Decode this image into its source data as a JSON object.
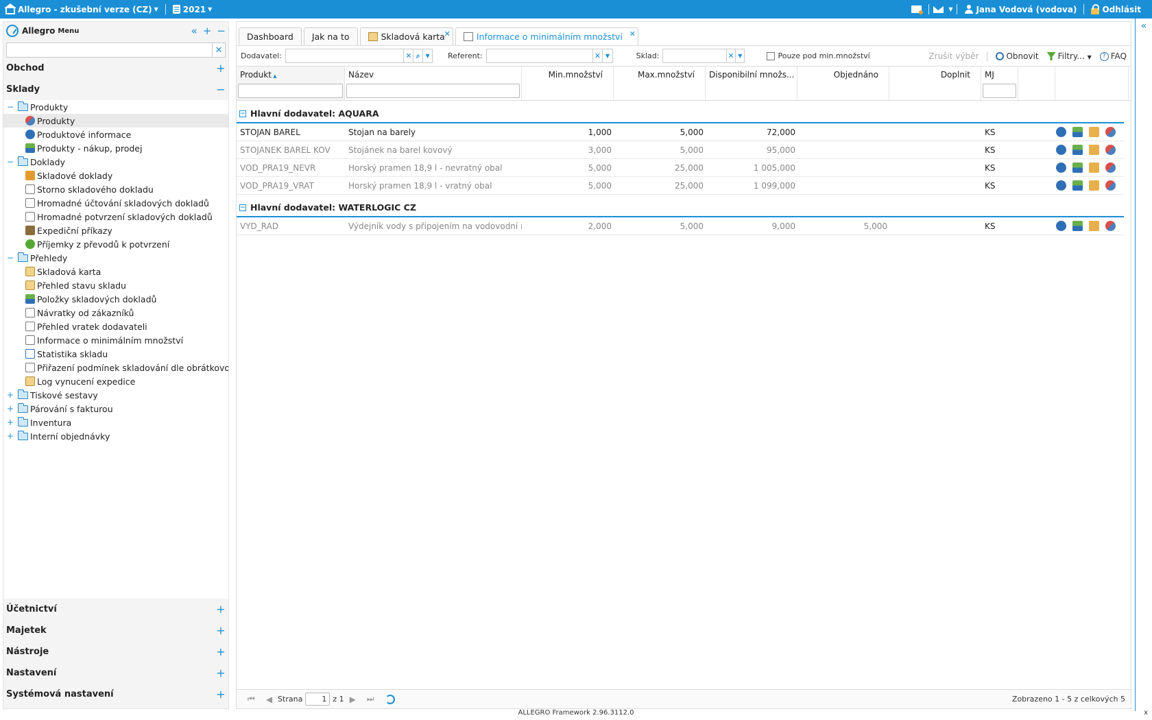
{
  "topbar": {
    "app_title": "Allegro - zkušební verze (CZ)",
    "year": "2021",
    "user": "Jana Vodová (vodova)",
    "logout": "Odhlásit"
  },
  "sidebar": {
    "logo": "Allegro",
    "menu_label": "Menu",
    "search_placeholder": "",
    "sections_top": [
      {
        "label": "Obchod",
        "toggle": "+"
      },
      {
        "label": "Sklady",
        "toggle": "−"
      }
    ],
    "tree": [
      {
        "label": "Produkty",
        "level": 0,
        "exp": "−",
        "icon": "folder-icon"
      },
      {
        "label": "Produkty",
        "level": 1,
        "icon": "product-icon",
        "selected": true
      },
      {
        "label": "Produktové informace",
        "level": 1,
        "icon": "info-icon"
      },
      {
        "label": "Produkty - nákup, prodej",
        "level": 1,
        "icon": "buy-sell-icon"
      },
      {
        "label": "Doklady",
        "level": 0,
        "exp": "−",
        "icon": "folder-icon"
      },
      {
        "label": "Skladové doklady",
        "level": 1,
        "icon": "warehouse-doc-icon"
      },
      {
        "label": "Storno skladového dokladu",
        "level": 1,
        "icon": "storno-icon"
      },
      {
        "label": "Hromadné účtování skladových dokladů",
        "level": 1,
        "icon": "bulk-accounting-icon"
      },
      {
        "label": "Hromadné potvrzení skladových dokladů",
        "level": 1,
        "icon": "bulk-confirm-icon"
      },
      {
        "label": "Expediční příkazy",
        "level": 1,
        "icon": "truck-icon"
      },
      {
        "label": "Příjemky z převodů k potvrzení",
        "level": 1,
        "icon": "check-icon"
      },
      {
        "label": "Přehledy",
        "level": 0,
        "exp": "−",
        "icon": "folder-icon"
      },
      {
        "label": "Skladová karta",
        "level": 1,
        "icon": "stock-card-icon"
      },
      {
        "label": "Přehled stavu skladu",
        "level": 1,
        "icon": "stock-status-icon"
      },
      {
        "label": "Položky skladových dokladů",
        "level": 1,
        "icon": "doc-items-icon"
      },
      {
        "label": "Návratky od zákazníků",
        "level": 1,
        "icon": "returns-icon"
      },
      {
        "label": "Přehled vratek dodavateli",
        "level": 1,
        "icon": "supplier-returns-icon"
      },
      {
        "label": "Informace o minimálním množství",
        "level": 1,
        "icon": "min-qty-icon"
      },
      {
        "label": "Statistika skladu",
        "level": 1,
        "icon": "stats-icon"
      },
      {
        "label": "Přiřazení podmínek skladování dle obrátkovosti",
        "level": 1,
        "icon": "storage-conditions-icon"
      },
      {
        "label": "Log vynucení expedice",
        "level": 1,
        "icon": "log-icon"
      },
      {
        "label": "Tiskové sestavy",
        "level": 0,
        "exp": "+",
        "icon": "folder-icon"
      },
      {
        "label": "Párování s fakturou",
        "level": 0,
        "exp": "+",
        "icon": "folder-icon"
      },
      {
        "label": "Inventura",
        "level": 0,
        "exp": "+",
        "icon": "folder-icon"
      },
      {
        "label": "Interní objednávky",
        "level": 0,
        "exp": "+",
        "icon": "folder-icon"
      }
    ],
    "sections_bottom": [
      {
        "label": "Účetnictví",
        "toggle": "+"
      },
      {
        "label": "Majetek",
        "toggle": "+"
      },
      {
        "label": "Nástroje",
        "toggle": "+"
      },
      {
        "label": "Nastavení",
        "toggle": "+"
      },
      {
        "label": "Systémová nastavení",
        "toggle": "+"
      }
    ]
  },
  "tabs": [
    {
      "label": "Dashboard"
    },
    {
      "label": "Jak na to"
    },
    {
      "label": "Skladová karta",
      "icon": "stock-card-icon",
      "closable": true
    },
    {
      "label": "Informace o minimálním množství",
      "icon": "min-qty-icon",
      "closable": true,
      "active": true
    }
  ],
  "toolbar": {
    "supplier_label": "Dodavatel:",
    "referent_label": "Referent:",
    "warehouse_label": "Sklad:",
    "only_below_min": "Pouze pod min.množství",
    "clear_selection": "Zrušit výběr",
    "refresh": "Obnovit",
    "filters": "Filtry...",
    "faq": "FAQ"
  },
  "grid": {
    "columns": [
      "Produkt",
      "Název",
      "Min.množství",
      "Max.množství",
      "Disponibilní množs...",
      "Objednáno",
      "Doplnit",
      "MJ"
    ],
    "groups": [
      {
        "title": "Hlavní dodavatel: AQUARA",
        "rows": [
          {
            "code": "STOJAN BAREL",
            "name": "Stojan na barely",
            "min": "1,000",
            "max": "5,000",
            "avail": "72,000",
            "ordered": "",
            "refill": "",
            "unit": "KS",
            "dim": false
          },
          {
            "code": "STOJANEK BAREL KOV",
            "name": "Stojánek na barel kovový",
            "min": "3,000",
            "max": "5,000",
            "avail": "95,000",
            "ordered": "",
            "refill": "",
            "unit": "KS",
            "dim": true
          },
          {
            "code": "VOD_PRA19_NEVR",
            "name": "Horský pramen 18,9 l - nevratný obal",
            "min": "5,000",
            "max": "25,000",
            "avail": "1 005,000",
            "ordered": "",
            "refill": "",
            "unit": "KS",
            "dim": true
          },
          {
            "code": "VOD_PRA19_VRAT",
            "name": "Horský pramen 18,9 l - vratný obal",
            "min": "5,000",
            "max": "25,000",
            "avail": "1 099,000",
            "ordered": "",
            "refill": "",
            "unit": "KS",
            "dim": true
          }
        ]
      },
      {
        "title": "Hlavní dodavatel: WATERLOGIC CZ",
        "rows": [
          {
            "code": "VYD_RAD",
            "name": "Výdejník vody s připojením na vodovodní řád",
            "min": "2,000",
            "max": "5,000",
            "avail": "9,000",
            "ordered": "5,000",
            "refill": "",
            "unit": "KS",
            "dim": true
          }
        ]
      }
    ]
  },
  "pager": {
    "page_label": "Strana",
    "page_value": "1",
    "of_label": "z 1",
    "info": "Zobrazeno 1 - 5 z celkových 5"
  },
  "footer": {
    "text": "ALLEGRO Framework 2.96.3112.0",
    "close": "x"
  }
}
